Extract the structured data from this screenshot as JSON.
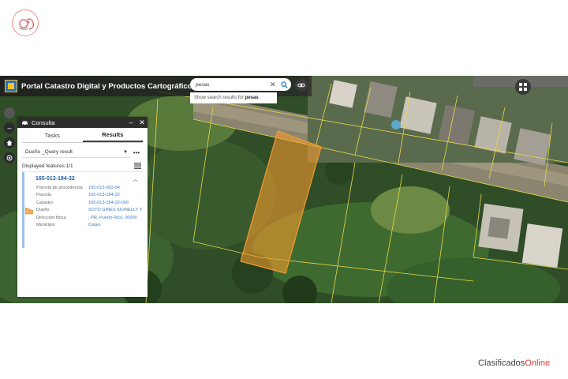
{
  "watermark": {
    "part1": "Clasificados",
    "part2": "Online"
  },
  "portal": {
    "title": "Portal Catastro Digital y Productos Cartográficos"
  },
  "search": {
    "value": "pesas",
    "suggestion_prefix": "Show search results for",
    "suggestion_term": "pesas"
  },
  "panel": {
    "title": "Consulta",
    "minimize": "–",
    "close": "✕",
    "tabs": [
      "Tasks",
      "Results"
    ],
    "query": "Dueño _Query result",
    "query_more": "•••",
    "features": "Displayed features:1/1",
    "result": {
      "id": "165-013-184-32",
      "attributes": [
        {
          "label": "Parcela de procedencia",
          "value": "165-013-003-04"
        },
        {
          "label": "Parcela",
          "value": "165-013-184-32"
        },
        {
          "label": "Catastro",
          "value": "165-013-184-32-000"
        },
        {
          "label": "Dueño",
          "value": "SOTO GINES KIONELLY Y"
        },
        {
          "label": "Dirección fisica",
          "value": ", PR, Puerto Rico, 00000"
        },
        {
          "label": "Municipio",
          "value": "Ciales"
        }
      ]
    }
  },
  "icons": {
    "brand": "ad-logo-icon",
    "portal": "catastro-logo-icon",
    "search": "search-icon",
    "link": "link-icon",
    "apps": "apps-grid-icon"
  },
  "colors": {
    "parcel_highlight": "#f39b2f",
    "boundary": "#e8d84a",
    "accent": "#1f5fa5"
  }
}
